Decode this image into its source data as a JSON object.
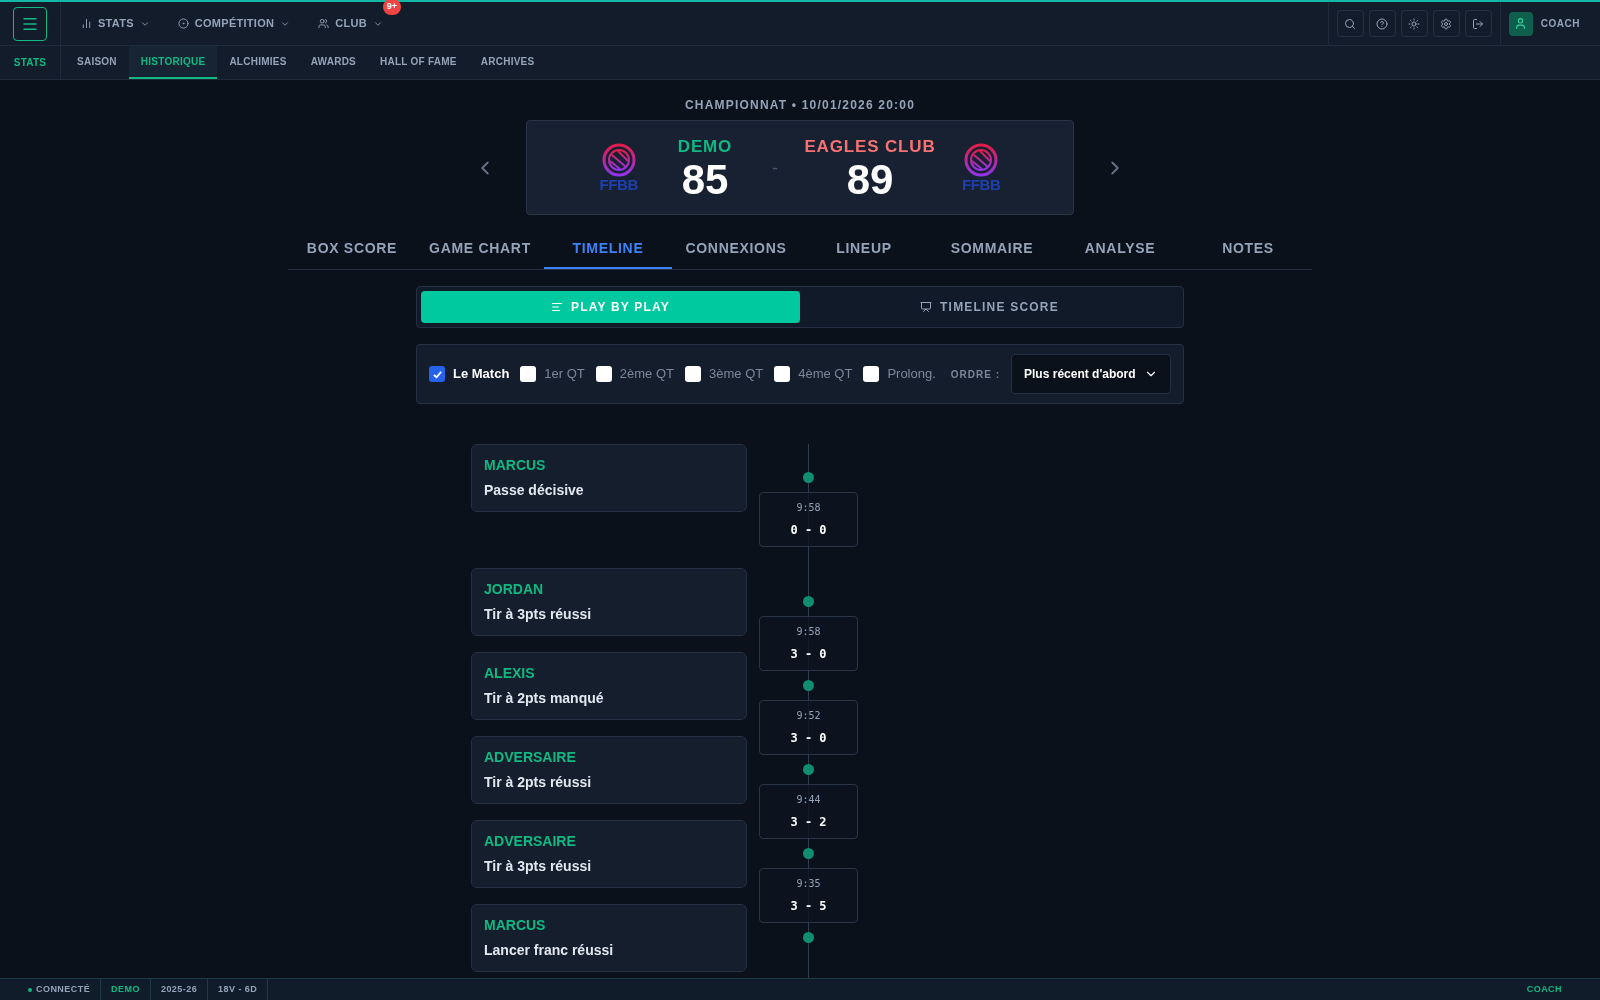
{
  "top_nav": {
    "menu": [
      {
        "label": "STATS"
      },
      {
        "label": "COMPÉTITION"
      },
      {
        "label": "CLUB",
        "badge": "9+"
      }
    ],
    "user": "COACH"
  },
  "sub_nav": {
    "section": "STATS",
    "items": [
      {
        "label": "SAISON",
        "selected": false
      },
      {
        "label": "HISTORIQUE",
        "selected": true
      },
      {
        "label": "ALCHIMIES",
        "selected": false
      },
      {
        "label": "AWARDS",
        "selected": false
      },
      {
        "label": "HALL OF FAME",
        "selected": false
      },
      {
        "label": "ARCHIVES",
        "selected": false
      }
    ]
  },
  "match": {
    "heading": "CHAMPIONNAT • 10/01/2026 20:00",
    "home": {
      "name": "DEMO",
      "score": "85",
      "logo": "FFBB"
    },
    "separator": "-",
    "away": {
      "name": "EAGLES CLUB",
      "score": "89",
      "logo": "FFBB"
    }
  },
  "tabs": [
    {
      "label": "BOX SCORE",
      "selected": false
    },
    {
      "label": "GAME CHART",
      "selected": false
    },
    {
      "label": "TIMELINE",
      "selected": true
    },
    {
      "label": "CONNEXIONS",
      "selected": false
    },
    {
      "label": "LINEUP",
      "selected": false
    },
    {
      "label": "SOMMAIRE",
      "selected": false
    },
    {
      "label": "ANALYSE",
      "selected": false
    },
    {
      "label": "NOTES",
      "selected": false
    }
  ],
  "view_toggle": [
    {
      "label": "PLAY BY PLAY",
      "selected": true
    },
    {
      "label": "TIMELINE SCORE",
      "selected": false
    }
  ],
  "filters": {
    "periods": [
      {
        "label": "Le Match",
        "checked": true
      },
      {
        "label": "1er QT",
        "checked": false
      },
      {
        "label": "2ème QT",
        "checked": false
      },
      {
        "label": "3ème QT",
        "checked": false
      },
      {
        "label": "4ème QT",
        "checked": false
      },
      {
        "label": "Prolong.",
        "checked": false
      }
    ],
    "order_label": "ORDRE :",
    "order_value": "Plus récent d'abord"
  },
  "events": [
    {
      "player": "MARCUS",
      "action": "Passe décisive",
      "time": "9:58",
      "score": "0 - 0"
    },
    {
      "player": "JORDAN",
      "action": "Tir à 3pts réussi",
      "time": "9:58",
      "score": "3 - 0"
    },
    {
      "player": "ALEXIS",
      "action": "Tir à 2pts manqué",
      "time": "9:52",
      "score": "3 - 0"
    },
    {
      "player": "ADVERSAIRE",
      "action": "Tir à 2pts réussi",
      "time": "9:44",
      "score": "3 - 2"
    },
    {
      "player": "ADVERSAIRE",
      "action": "Tir à 3pts réussi",
      "time": "9:35",
      "score": "3 - 5"
    },
    {
      "player": "MARCUS",
      "action": "Lancer franc réussi"
    }
  ],
  "status_bar": {
    "status": "CONNECTÉ",
    "team": "DEMO",
    "season": "2025-26",
    "record": "18V - 6D",
    "user": "COACH"
  }
}
